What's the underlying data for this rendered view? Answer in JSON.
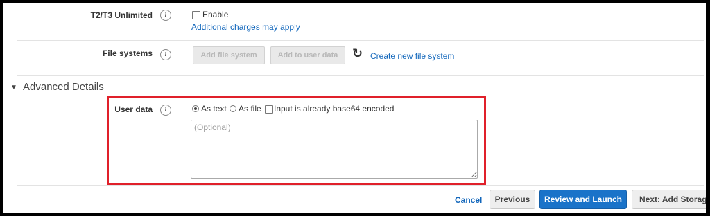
{
  "t2t3": {
    "label": "T2/T3 Unlimited",
    "info_icon": "i",
    "enable_label": "Enable",
    "charges_link": "Additional charges may apply"
  },
  "file_systems": {
    "label": "File systems",
    "info_icon": "i",
    "add_fs_button": "Add file system",
    "add_user_data_button": "Add to user data",
    "refresh_icon": "↻",
    "create_link": "Create new file system"
  },
  "advanced": {
    "toggle_icon": "▼",
    "title": "Advanced Details"
  },
  "user_data": {
    "label": "User data",
    "info_icon": "i",
    "as_text_label": "As text",
    "as_file_label": "As file",
    "base64_label": "Input is already base64 encoded",
    "selected_option": "As text",
    "textarea_placeholder": "(Optional)",
    "textarea_value": "",
    "highlight_color": "#e0202a"
  },
  "footer": {
    "cancel_label": "Cancel",
    "previous_label": "Previous",
    "review_label": "Review and Launch",
    "next_label": "Next: Add Storage",
    "primary_color": "#1a73c9"
  }
}
